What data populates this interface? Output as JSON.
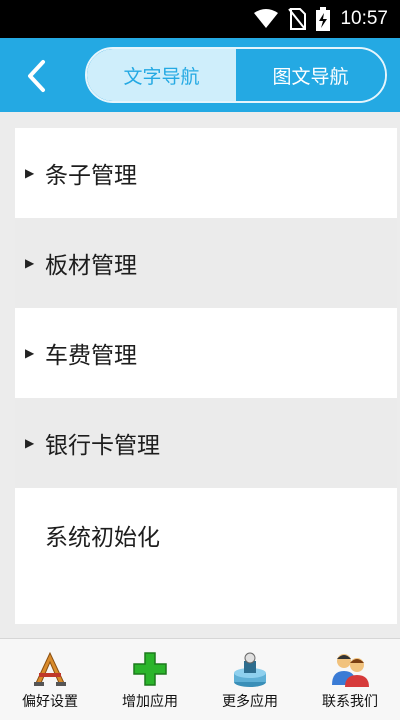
{
  "status_bar": {
    "time": "10:57"
  },
  "header": {
    "tabs": [
      {
        "label": "文字导航",
        "active": true
      },
      {
        "label": "图文导航",
        "active": false
      }
    ]
  },
  "menu": {
    "items": [
      {
        "label": "条子管理",
        "has_arrow": true
      },
      {
        "label": "板材管理",
        "has_arrow": true
      },
      {
        "label": "车费管理",
        "has_arrow": true
      },
      {
        "label": "银行卡管理",
        "has_arrow": true
      },
      {
        "label": "系统初始化",
        "has_arrow": false
      }
    ]
  },
  "bottom_nav": {
    "items": [
      {
        "label": "偏好设置",
        "icon": "preferences-icon"
      },
      {
        "label": "增加应用",
        "icon": "add-app-icon"
      },
      {
        "label": "更多应用",
        "icon": "more-apps-icon"
      },
      {
        "label": "联系我们",
        "icon": "contact-us-icon"
      }
    ]
  },
  "colors": {
    "header_bg": "#24a9e3",
    "tab_active_bg": "#cfeefb",
    "row_alt_bg": "#ebebeb"
  }
}
